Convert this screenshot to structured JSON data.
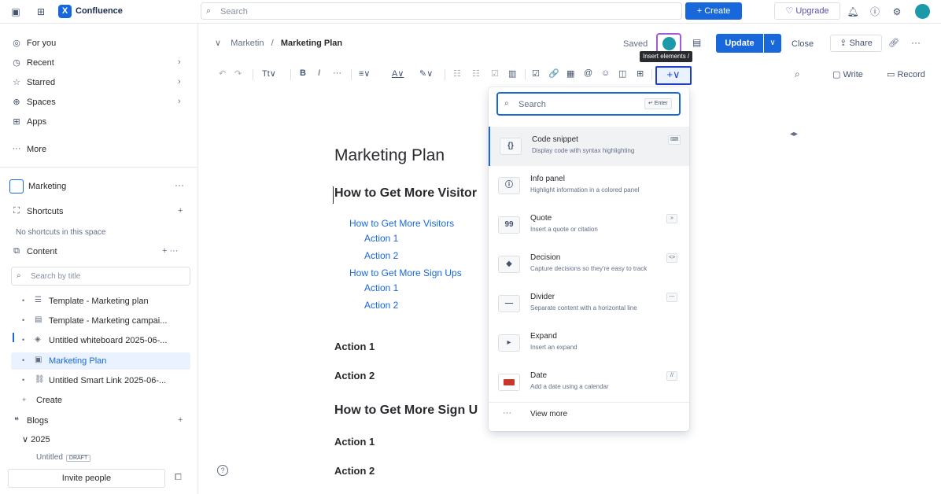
{
  "topbar": {
    "app_name": "Confluence",
    "app_logo": "X",
    "search_placeholder": "Search",
    "create_label": "+ Create",
    "upgrade_label": "♡ Upgrade"
  },
  "sidebar": {
    "nav": [
      {
        "icon": "person-icon",
        "glyph": "◎",
        "label": "For you",
        "chevron": ""
      },
      {
        "icon": "clock-icon",
        "glyph": "◷",
        "label": "Recent",
        "chevron": "›"
      },
      {
        "icon": "star-icon",
        "glyph": "☆",
        "label": "Starred",
        "chevron": "›"
      },
      {
        "icon": "globe-icon",
        "glyph": "⊕",
        "label": "Spaces",
        "chevron": "›"
      },
      {
        "icon": "apps-icon",
        "glyph": "⊞",
        "label": "Apps",
        "chevron": ""
      },
      {
        "icon": "more-icon",
        "glyph": "···",
        "label": "More",
        "chevron": ""
      }
    ],
    "space_name": "Marketing",
    "shortcuts_label": "Shortcuts",
    "no_shortcuts": "No shortcuts in this space",
    "content_label": "Content",
    "tree_search_placeholder": "Search by title",
    "tree": [
      {
        "glyph": "☰",
        "label": "Template - Marketing plan"
      },
      {
        "glyph": "▤",
        "label": "Template - Marketing campai..."
      },
      {
        "glyph": "◈",
        "label": "Untitled whiteboard 2025-06-..."
      },
      {
        "glyph": "▣",
        "label": "Marketing Plan"
      },
      {
        "glyph": "⛓",
        "label": "Untitled Smart Link 2025-06-..."
      }
    ],
    "create_label": "Create",
    "blogs_label": "Blogs",
    "year_label": "2025",
    "draft_label": "Untitled",
    "draft_badge": "DRAFT",
    "invite_label": "Invite people"
  },
  "editor": {
    "breadcrumb_parent": "Marketin",
    "breadcrumb_sep": "/",
    "breadcrumb_current": "Marketing Plan",
    "saved_label": "Saved",
    "tooltip": "Insert elements /",
    "update_label": "Update",
    "close_label": "Close",
    "share_label": "Share",
    "write_label": "Write",
    "record_label": "Record"
  },
  "toolbar": {
    "undo": "↶",
    "redo": "↷",
    "text_style": "Tt",
    "bold": "B",
    "italic": "I",
    "more": "···",
    "align": "≡",
    "text_color": "A",
    "highlight": "✎",
    "bullet_list": "☷",
    "numbered_list": "☷",
    "task_list": "☑",
    "layout": "▥",
    "action_item": "☑",
    "link": "🔗",
    "image": "▦",
    "mention": "@",
    "emoji": "☺",
    "table_col": "◫",
    "table": "⊞",
    "insert": "+∨"
  },
  "document": {
    "title": "Marketing Plan",
    "h2_1": "How to Get More Visitor",
    "toc": [
      {
        "label": "How to Get More Visitors",
        "indent": 0
      },
      {
        "label": "Action 1",
        "indent": 1
      },
      {
        "label": "Action 2",
        "indent": 1
      },
      {
        "label": "How to Get More Sign Ups",
        "indent": 0
      },
      {
        "label": "Action 1",
        "indent": 1
      },
      {
        "label": "Action 2",
        "indent": 1
      }
    ],
    "h3_a1": "Action 1",
    "h3_a2": "Action 2",
    "h2_2": "How to Get More Sign U",
    "h3_b1": "Action 1",
    "h3_b2": "Action 2"
  },
  "insert_menu": {
    "search_placeholder": "Search",
    "enter_hint": "↵ Enter",
    "items": [
      {
        "title": "Code snippet",
        "desc": "Display code with syntax highlighting",
        "key": "⌨",
        "thumb": "{}"
      },
      {
        "title": "Info panel",
        "desc": "Highlight information in a colored panel",
        "key": "",
        "thumb": "ⓘ"
      },
      {
        "title": "Quote",
        "desc": "Insert a quote or citation",
        "key": "»",
        "thumb": "99"
      },
      {
        "title": "Decision",
        "desc": "Capture decisions so they're easy to track",
        "key": "<>",
        "thumb": "◆"
      },
      {
        "title": "Divider",
        "desc": "Separate content with a horizontal line",
        "key": "---",
        "thumb": "—"
      },
      {
        "title": "Expand",
        "desc": "Insert an expand",
        "key": "",
        "thumb": "▸"
      },
      {
        "title": "Date",
        "desc": "Add a date using a calendar",
        "key": "//",
        "thumb": ""
      }
    ],
    "view_more": "View more"
  }
}
